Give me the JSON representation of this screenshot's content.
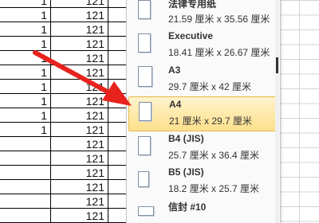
{
  "sheet": {
    "rows": [
      {
        "a": "1",
        "b": "121"
      },
      {
        "a": "1",
        "b": "121"
      },
      {
        "a": "1",
        "b": "121"
      },
      {
        "a": "1",
        "b": "121"
      },
      {
        "a": "1",
        "b": "121"
      },
      {
        "a": "1",
        "b": "121"
      },
      {
        "a": "1",
        "b": "121"
      },
      {
        "a": "1",
        "b": "121"
      },
      {
        "a": "1",
        "b": "121"
      },
      {
        "a": "1",
        "b": "121"
      },
      {
        "a": "",
        "b": "121"
      },
      {
        "a": "",
        "b": "121"
      },
      {
        "a": "",
        "b": "121"
      },
      {
        "a": "",
        "b": "121"
      },
      {
        "a": "",
        "b": "121"
      },
      {
        "a": "",
        "b": "121"
      }
    ]
  },
  "menu": {
    "items": [
      {
        "name": "法律专用纸",
        "dims": "21.59 厘米 x 35.56 厘米"
      },
      {
        "name": "Executive",
        "dims": "18.41 厘米 x 26.67 厘米"
      },
      {
        "name": "A3",
        "dims": "29.7 厘米 x 42 厘米"
      },
      {
        "name": "A4",
        "dims": "21 厘米 x 29.7 厘米"
      },
      {
        "name": "B4 (JIS)",
        "dims": "25.7 厘米 x 36.4 厘米"
      },
      {
        "name": "B5 (JIS)",
        "dims": "18.2 厘米 x 25.7 厘米"
      },
      {
        "name": "信封 #10",
        "dims": ""
      }
    ],
    "selected_index": 3
  },
  "colors": {
    "arrow": "#e8221d",
    "selected_fill": "#fde08c",
    "selected_border": "#e7b94a"
  }
}
